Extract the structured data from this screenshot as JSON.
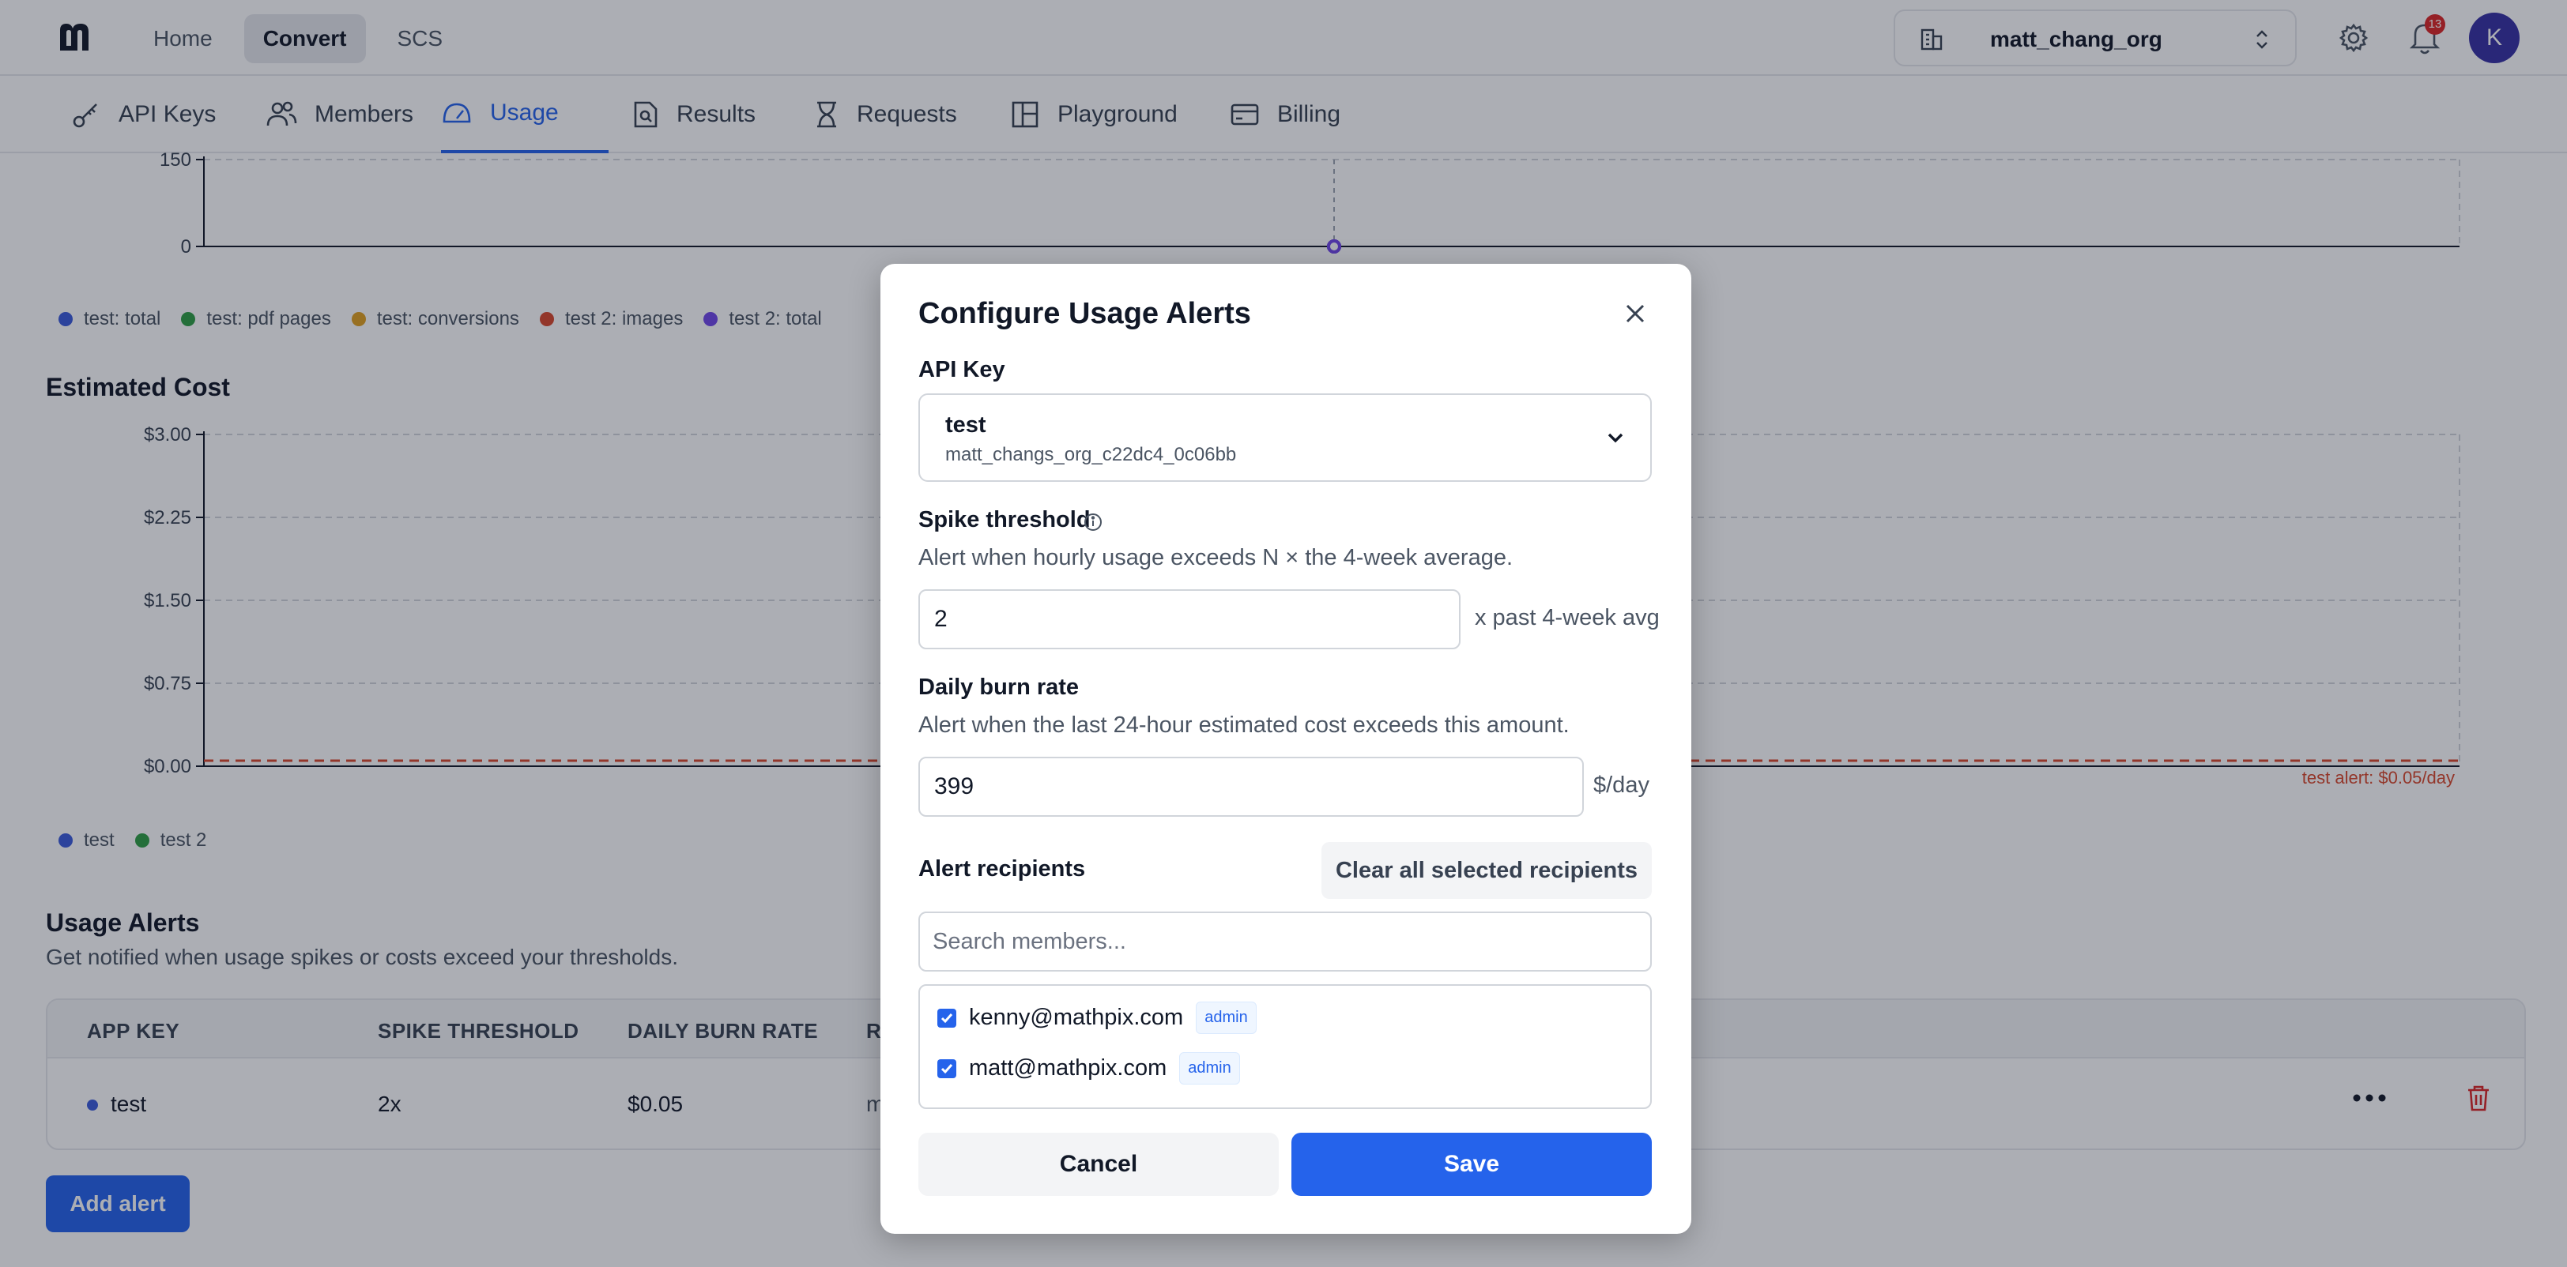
{
  "topnav": {
    "items": [
      {
        "label": "Home",
        "active": false
      },
      {
        "label": "Convert",
        "active": true
      },
      {
        "label": "SCS",
        "active": false
      }
    ],
    "org_name": "matt_chang_org",
    "notification_count": "13",
    "avatar_initial": "K"
  },
  "subnav": {
    "items": [
      {
        "label": "API Keys",
        "icon": "key-icon"
      },
      {
        "label": "Members",
        "icon": "users-icon"
      },
      {
        "label": "Usage",
        "icon": "gauge-icon",
        "active": true
      },
      {
        "label": "Results",
        "icon": "file-search-icon"
      },
      {
        "label": "Requests",
        "icon": "hourglass-icon"
      },
      {
        "label": "Playground",
        "icon": "layout-icon"
      },
      {
        "label": "Billing",
        "icon": "credit-card-icon"
      }
    ]
  },
  "usage_chart": {
    "legend": [
      {
        "label": "test: total",
        "color": "#3b5bdb"
      },
      {
        "label": "test: pdf pages",
        "color": "#2f9e44"
      },
      {
        "label": "test: conversions",
        "color": "#e0a01f"
      },
      {
        "label": "test 2: images",
        "color": "#d9482b"
      },
      {
        "label": "test 2: total",
        "color": "#7048e8"
      }
    ]
  },
  "chart_data": [
    {
      "type": "line",
      "title": "",
      "y_ticks": [
        "150",
        "0"
      ],
      "ylim": [
        0,
        150
      ],
      "series": [
        {
          "name": "test: total",
          "values": [
            0
          ]
        },
        {
          "name": "test: pdf pages",
          "values": [
            0
          ]
        },
        {
          "name": "test: conversions",
          "values": [
            0
          ]
        },
        {
          "name": "test 2: images",
          "values": [
            0
          ]
        },
        {
          "name": "test 2: total",
          "values": [
            0
          ]
        }
      ],
      "grid": true
    },
    {
      "type": "line",
      "title": "Estimated Cost",
      "y_ticks": [
        "$3.00",
        "$2.25",
        "$1.50",
        "$0.75",
        "$0.00"
      ],
      "ylim": [
        0,
        3.0
      ],
      "series": [
        {
          "name": "test",
          "values": [
            0
          ]
        },
        {
          "name": "test 2",
          "values": [
            0
          ]
        }
      ],
      "threshold": {
        "label": "test alert: $0.05/day",
        "value": 0.05,
        "color": "#d9482b"
      },
      "grid": true
    }
  ],
  "cost_chart": {
    "title": "Estimated Cost",
    "threshold_label": "test alert: $0.05/day",
    "legend": [
      {
        "label": "test",
        "color": "#3b5bdb"
      },
      {
        "label": "test 2",
        "color": "#2f9e44"
      }
    ]
  },
  "usage_alerts": {
    "title": "Usage Alerts",
    "subtitle": "Get notified when usage spikes or costs exceed your thresholds.",
    "columns": [
      "APP KEY",
      "SPIKE THRESHOLD",
      "DAILY BURN RATE",
      "R"
    ],
    "row": {
      "app_key": "test",
      "spike_threshold": "2x",
      "daily_burn_rate": "$0.05",
      "recipients_partial": "m"
    },
    "add_button": "Add alert"
  },
  "modal": {
    "title": "Configure Usage Alerts",
    "api_key_label": "API Key",
    "api_key_name": "test",
    "api_key_id": "matt_changs_org_c22dc4_0c06bb",
    "spike_label": "Spike threshold",
    "spike_help": "Alert when hourly usage exceeds N × the 4-week average.",
    "spike_value": "2",
    "spike_suffix": "x past 4-week avg",
    "burn_label": "Daily burn rate",
    "burn_help": "Alert when the last 24-hour estimated cost exceeds this amount.",
    "burn_value": "399",
    "burn_suffix": "$/day",
    "recipients_label": "Alert recipients",
    "clear_button": "Clear all selected recipients",
    "search_placeholder": "Search members...",
    "members": [
      {
        "email": "kenny@mathpix.com",
        "role": "admin",
        "checked": true
      },
      {
        "email": "matt@mathpix.com",
        "role": "admin",
        "checked": true
      }
    ],
    "cancel_button": "Cancel",
    "save_button": "Save"
  },
  "colors": {
    "accent": "#2563eb",
    "danger": "#d9482b"
  }
}
